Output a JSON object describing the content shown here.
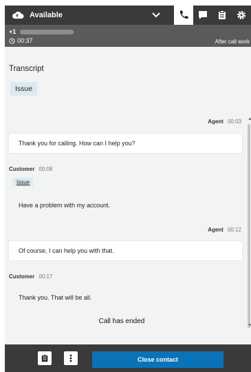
{
  "header": {
    "status_label": "Available",
    "status_color": "#ffffff",
    "tabs": [
      {
        "icon": "phone-icon",
        "active": true
      },
      {
        "icon": "chat-icon",
        "active": false
      },
      {
        "icon": "clipboard-icon",
        "active": false
      },
      {
        "icon": "gear-icon",
        "active": false
      }
    ]
  },
  "contact": {
    "phone_prefix": "+1",
    "timer": "00:37",
    "state": "After call work"
  },
  "transcript": {
    "title": "Transcript",
    "issue_label": "Issue",
    "messages": [
      {
        "speaker": "Agent",
        "time": "00:03",
        "text": "Thank you for calling. How can I help you?"
      },
      {
        "speaker": "Customer",
        "time": "00:08",
        "tag": "Issue",
        "text": "Have a problem with my account."
      },
      {
        "speaker": "Agent",
        "time": "00:12",
        "text": "Of course, I can help you with that."
      },
      {
        "speaker": "Customer",
        "time": "00:17",
        "text": "Thank you. That will be all."
      }
    ],
    "ended_text": "Call has ended"
  },
  "footer": {
    "close_label": "Close contact",
    "accent_color": "#0a73b8"
  }
}
